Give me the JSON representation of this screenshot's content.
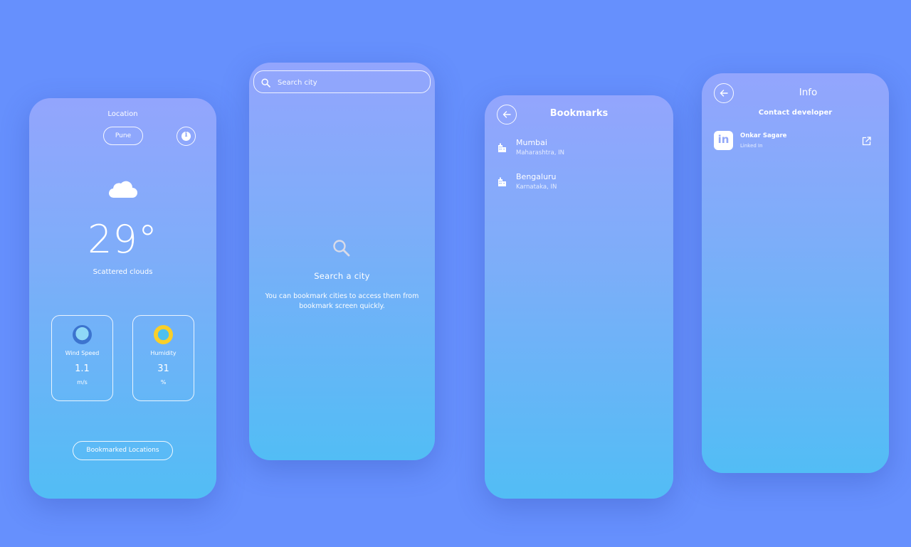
{
  "weather_screen": {
    "location_label": "Location",
    "city": "Pune",
    "condition_icon": "cloud-icon",
    "temperature": "29°",
    "condition": "Scattered clouds",
    "stats": [
      {
        "icon": "wind-icon",
        "label": "Wind Speed",
        "value": "1.1",
        "unit": "m/s"
      },
      {
        "icon": "humidity-icon",
        "label": "Humidity",
        "value": "31",
        "unit": "%"
      }
    ],
    "bookmarks_button": "Bookmarked Locations"
  },
  "search_screen": {
    "placeholder": "Search city",
    "empty_title": "Search a city",
    "empty_desc": "You can bookmark cities to access them from bookmark screen quickly."
  },
  "bookmarks_screen": {
    "title": "Bookmarks",
    "items": [
      {
        "name": "Mumbai",
        "region": "Maharashtra, IN"
      },
      {
        "name": "Bengaluru",
        "region": "Karnataka, IN"
      }
    ]
  },
  "info_screen": {
    "title": "Info",
    "contact_title": "Contact developer",
    "developer": {
      "name": "Onkar Sagare",
      "platform": "Linked In",
      "logo_text": "in"
    }
  },
  "colors": {
    "background": "#6690fd",
    "gradient_top": "#93a5fd",
    "gradient_bottom": "#52bdf5"
  }
}
